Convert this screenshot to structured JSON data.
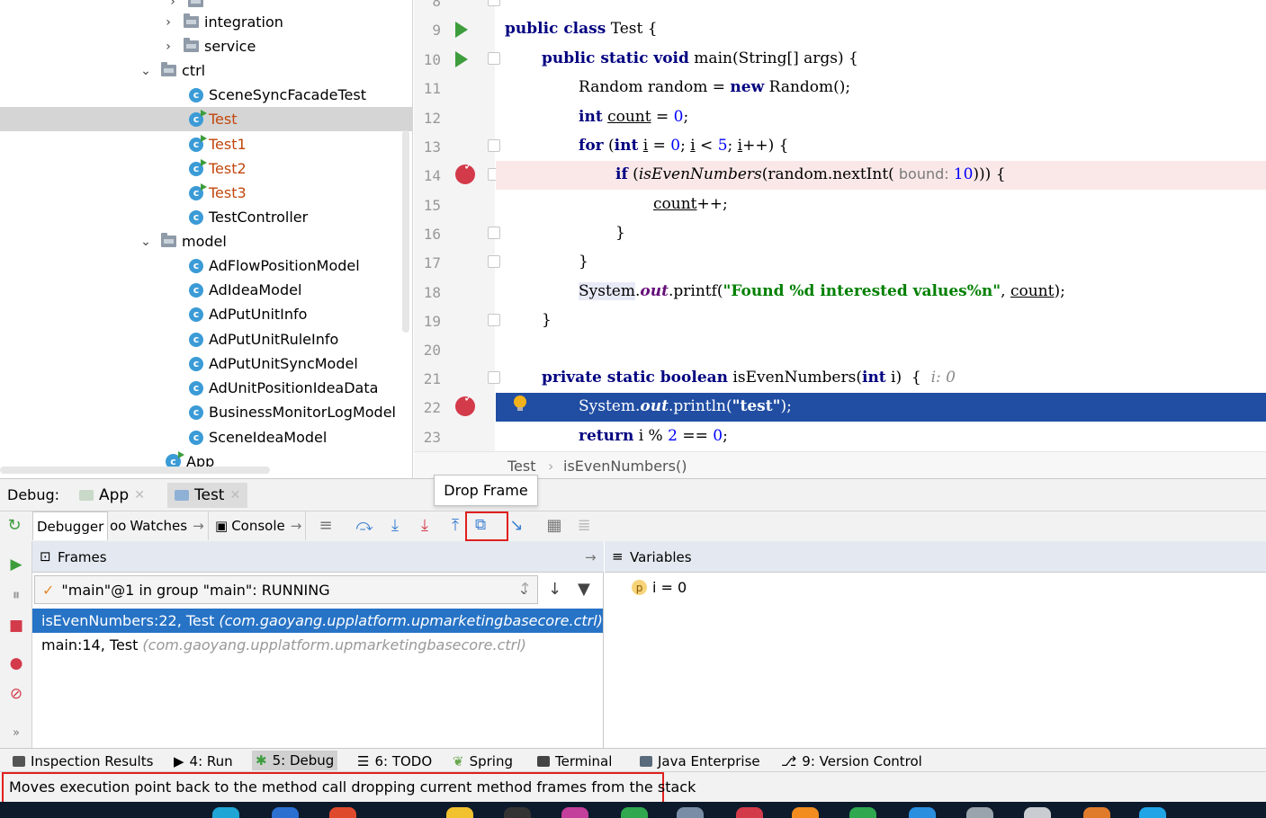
{
  "tree": {
    "items": [
      {
        "label": "integration",
        "kind": "folder",
        "expanded": false
      },
      {
        "label": "service",
        "kind": "folder",
        "expanded": false
      },
      {
        "label": "ctrl",
        "kind": "folder",
        "expanded": true
      },
      {
        "label": "SceneSyncFacadeTest",
        "kind": "class"
      },
      {
        "label": "Test",
        "kind": "runnable-class",
        "selected": true
      },
      {
        "label": "Test1",
        "kind": "runnable-class"
      },
      {
        "label": "Test2",
        "kind": "runnable-class"
      },
      {
        "label": "Test3",
        "kind": "runnable-class"
      },
      {
        "label": "TestController",
        "kind": "class"
      },
      {
        "label": "model",
        "kind": "folder",
        "expanded": true
      },
      {
        "label": "AdFlowPositionModel",
        "kind": "class"
      },
      {
        "label": "AdIdeaModel",
        "kind": "class"
      },
      {
        "label": "AdPutUnitInfo",
        "kind": "class"
      },
      {
        "label": "AdPutUnitRuleInfo",
        "kind": "class"
      },
      {
        "label": "AdPutUnitSyncModel",
        "kind": "class"
      },
      {
        "label": "AdUnitPositionIdeaData",
        "kind": "class"
      },
      {
        "label": "BusinessMonitorLogModel",
        "kind": "class"
      },
      {
        "label": "SceneIdeaModel",
        "kind": "class"
      },
      {
        "label": "App",
        "kind": "app-class"
      }
    ]
  },
  "editor": {
    "lines": [
      {
        "n": "8"
      },
      {
        "n": "9"
      },
      {
        "n": "10"
      },
      {
        "n": "11"
      },
      {
        "n": "12"
      },
      {
        "n": "13"
      },
      {
        "n": "14"
      },
      {
        "n": "15"
      },
      {
        "n": "16"
      },
      {
        "n": "17"
      },
      {
        "n": "18"
      },
      {
        "n": "19"
      },
      {
        "n": "20"
      },
      {
        "n": "21"
      },
      {
        "n": "22"
      },
      {
        "n": "23"
      }
    ],
    "code": {
      "l9_kw": "public class",
      "l9_name": " Test {",
      "l10_kw": "public static void",
      "l10_rest": " main(String[] args) {",
      "l11_a": "Random random = ",
      "l11_kw": "new",
      "l11_b": " Random();",
      "l12_kw": "int",
      "l12_var": "count",
      "l12_eq": " = ",
      "l12_num": "0",
      "l12_end": ";",
      "l13_kw": "for",
      "l13_a": " (",
      "l13_kw2": "int",
      "l13_b": " ",
      "l13_i": "i",
      "l13_c": " = ",
      "l13_n0": "0",
      "l13_d": "; ",
      "l13_i2": "i",
      "l13_e": " < ",
      "l13_n5": "5",
      "l13_f": "; ",
      "l13_i3": "i",
      "l13_g": "++) {",
      "l14_kw": "if",
      "l14_a": " (",
      "l14_m": "isEvenNumbers",
      "l14_b": "(random.nextInt(",
      "l14_hint": " bound: ",
      "l14_n": "10",
      "l14_c": "))) {",
      "l15_var": "count",
      "l15_end": "++;",
      "l16": "}",
      "l17": "}",
      "l18_sys": "System",
      "l18_dot": ".",
      "l18_out": "out",
      "l18_a": ".printf(",
      "l18_str": "\"Found %d interested values%n\"",
      "l18_b": ", ",
      "l18_var": "count",
      "l18_c": ");",
      "l19": "}",
      "l21_kw": "private static boolean",
      "l21_a": " isEvenNumbers(",
      "l21_kw2": "int",
      "l21_b": " i)  {",
      "l21_val": "  i: 0",
      "l22_sys": "System",
      "l22_dot": ".",
      "l22_out": "out",
      "l22_a": ".println(",
      "l22_str": "\"test\"",
      "l22_b": ");",
      "l23_kw": "return",
      "l23_a": " i % ",
      "l23_n2": "2",
      "l23_b": " == ",
      "l23_n0": "0",
      "l23_c": ";"
    }
  },
  "breadcrumb": {
    "file": "Test",
    "sep": "›",
    "method": "isEvenNumbers()"
  },
  "debug": {
    "label": "Debug:",
    "tabs": [
      {
        "label": "App"
      },
      {
        "label": "Test"
      }
    ],
    "subtabs": {
      "debugger": "Debugger",
      "watches": "Watches",
      "console": "Console"
    },
    "tooltip": "Drop Frame",
    "frames": {
      "header": "Frames",
      "thread": "\"main\"@1 in group \"main\": RUNNING",
      "rows": [
        {
          "text": "isEvenNumbers:22, Test",
          "pkg": "(com.gaoyang.upplatform.upmarketingbasecore.ctrl)"
        },
        {
          "text": "main:14, Test",
          "pkg": "(com.gaoyang.upplatform.upmarketingbasecore.ctrl)"
        }
      ]
    },
    "variables": {
      "header": "Variables",
      "items": [
        {
          "badge": "p",
          "text": "i = 0"
        }
      ]
    }
  },
  "toolwindows": {
    "items": [
      {
        "label": "Inspection Results"
      },
      {
        "label": "4: Run"
      },
      {
        "label": "5: Debug"
      },
      {
        "label": "6: TODO"
      },
      {
        "label": "Spring"
      },
      {
        "label": "Terminal"
      },
      {
        "label": "Java Enterprise"
      },
      {
        "label": "9: Version Control"
      }
    ]
  },
  "status": {
    "text": "Moves execution point back to the method call dropping current method frames from the stack"
  },
  "colors": {
    "accent": "#2773c6",
    "current_line": "#214ea3",
    "breakpoint": "#d33a4a",
    "highlight_box": "#e0201e"
  }
}
